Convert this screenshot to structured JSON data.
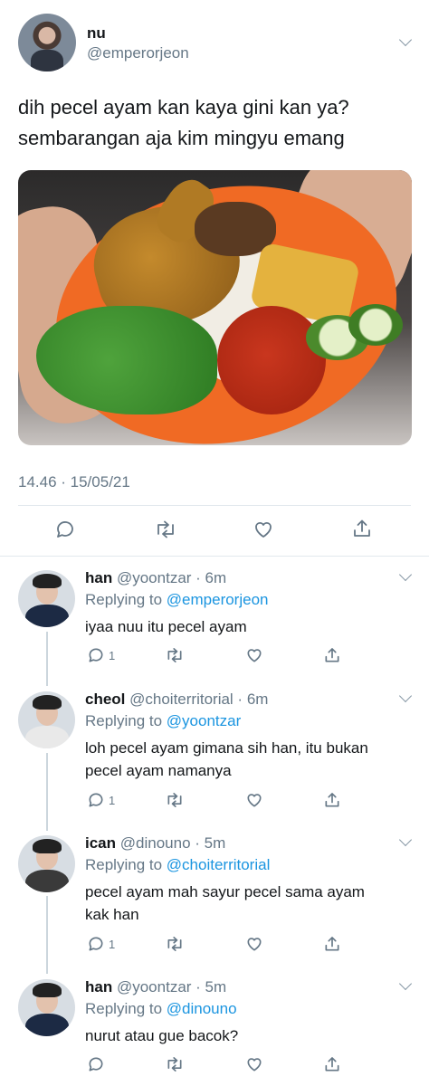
{
  "main_tweet": {
    "display_name": "nu",
    "handle": "@emperorjeon",
    "text_lines": [
      "dih pecel ayam kan kaya gini kan ya?",
      "sembarangan aja kim mingyu emang"
    ],
    "timestamp": "14.46 · 15/05/21",
    "actions": [
      {
        "icon": "reply-icon"
      },
      {
        "icon": "retweet-icon"
      },
      {
        "icon": "like-icon"
      },
      {
        "icon": "share-icon"
      }
    ]
  },
  "replies": [
    {
      "display_name": "han",
      "handle_time": "@yoontzar · 6m",
      "replying_prefix": "Replying to ",
      "replying_to": "@emperorjeon",
      "text_lines": [
        "iyaa nuu itu pecel ayam"
      ],
      "reply_count": "1"
    },
    {
      "display_name": "cheol",
      "handle_time": "@choiterritorial · 6m",
      "replying_prefix": "Replying to ",
      "replying_to": "@yoontzar",
      "text_lines": [
        "loh pecel ayam gimana sih han, itu bukan",
        "pecel ayam namanya"
      ],
      "reply_count": "1"
    },
    {
      "display_name": "ican",
      "handle_time": "@dinouno · 5m",
      "replying_prefix": "Replying to ",
      "replying_to": "@choiterritorial",
      "text_lines": [
        "pecel ayam mah sayur pecel sama ayam",
        "kak han"
      ],
      "reply_count": "1"
    },
    {
      "display_name": "han",
      "handle_time": "@yoontzar · 5m",
      "replying_prefix": "Replying to ",
      "replying_to": "@dinouno",
      "text_lines": [
        "nurut atau gue bacok?"
      ],
      "reply_count": ""
    }
  ],
  "colors": {
    "text": "#14171a",
    "secondary": "#657786",
    "mention": "#1b95e0",
    "divider": "#e1e8ed",
    "thread_line": "#ccd6dd"
  }
}
